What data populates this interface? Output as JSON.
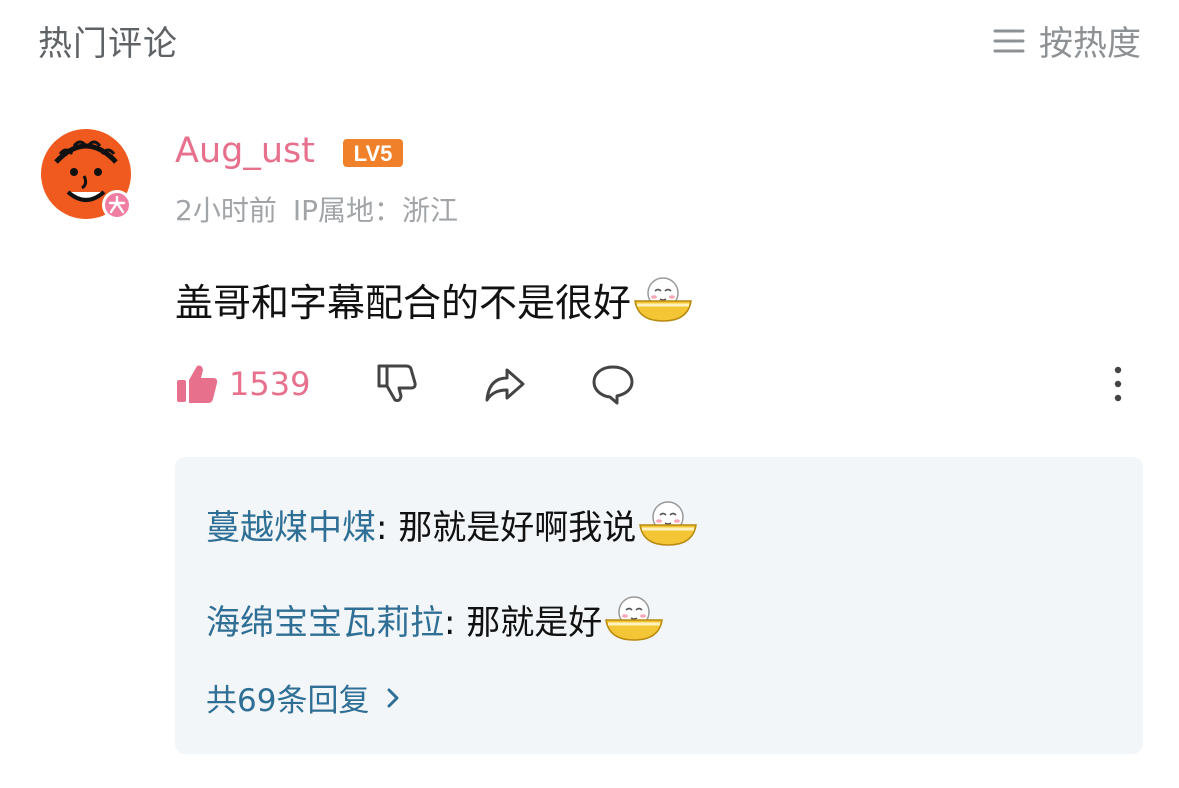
{
  "header": {
    "title": "热门评论",
    "sort_label": "按热度"
  },
  "comment": {
    "username": "Aug_ust",
    "level": "LV5",
    "time": "2小时前",
    "ip_label": "IP属地：浙江",
    "text": "盖哥和字幕配合的不是很好",
    "likes": "1539"
  },
  "replies": [
    {
      "name": "蔓越煤中煤",
      "text": ": 那就是好啊我说"
    },
    {
      "name": "海绵宝宝瓦莉拉",
      "text": ": 那就是好"
    }
  ],
  "more_replies": "共69条回复",
  "colors": {
    "username": "#e7708d",
    "reply_name": "#2f6f96",
    "reply_bg": "#f3f6f8",
    "avatar_bg": "#f05a1e",
    "badge": "#f0812a"
  },
  "icons": [
    "menu-lines-icon",
    "thumbs-up-icon",
    "thumbs-down-icon",
    "share-icon",
    "comment-icon",
    "more-vertical-icon",
    "bowl-face-emoji",
    "chevron-right-icon"
  ]
}
